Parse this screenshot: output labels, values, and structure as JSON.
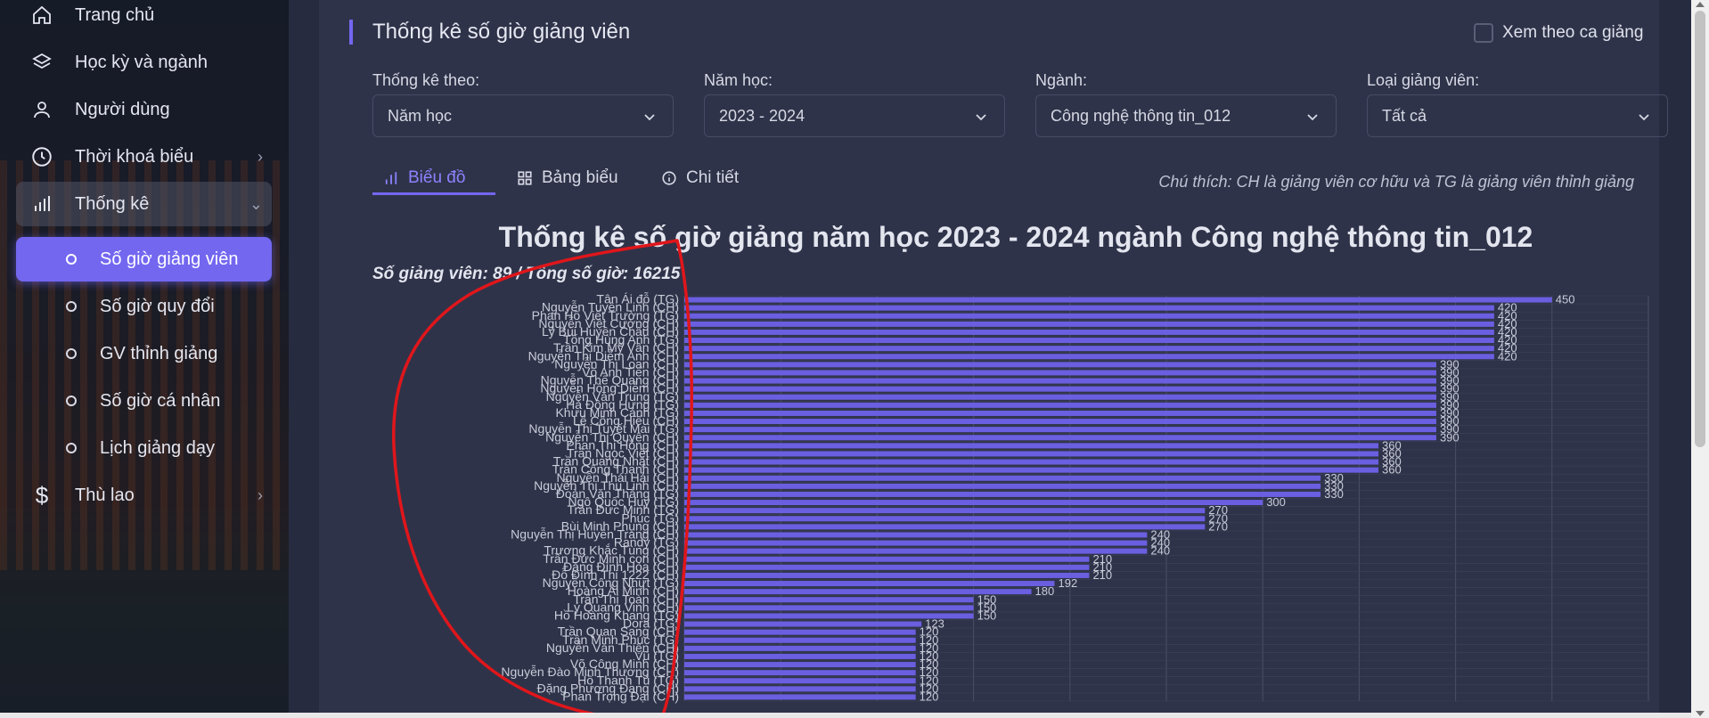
{
  "sidebar": {
    "items": [
      {
        "label": "Trang chủ",
        "icon": "home-icon"
      },
      {
        "label": "Học kỳ và ngành",
        "icon": "layers-icon"
      },
      {
        "label": "Người dùng",
        "icon": "user-icon"
      },
      {
        "label": "Thời khoá biểu",
        "icon": "clock-icon"
      },
      {
        "label": "Thống kê",
        "icon": "bar-chart-icon"
      }
    ],
    "sub_items": [
      {
        "label": "Số giờ giảng viên",
        "active": true
      },
      {
        "label": "Số giờ quy đổi"
      },
      {
        "label": "GV thỉnh giảng"
      },
      {
        "label": "Số giờ cá nhân"
      },
      {
        "label": "Lịch giảng dạy"
      }
    ],
    "last_item": {
      "label": "Thù lao",
      "icon": "dollar-icon"
    }
  },
  "header": {
    "title": "Thống kê số giờ giảng viên",
    "toggle_label": "Xem theo ca giảng"
  },
  "filters": [
    {
      "label": "Thống kê theo:",
      "value": "Năm học"
    },
    {
      "label": "Năm học:",
      "value": "2023 - 2024"
    },
    {
      "label": "Ngành:",
      "value": "Công nghệ thông tin_012"
    },
    {
      "label": "Loại giảng viên:",
      "value": "Tất cả"
    }
  ],
  "tabs": [
    {
      "label": "Biểu đồ",
      "icon": "bar-chart-icon",
      "active": true
    },
    {
      "label": "Bảng biểu",
      "icon": "grid-icon"
    },
    {
      "label": "Chi tiết",
      "icon": "info-icon"
    }
  ],
  "note": "Chú thích: CH là giảng viên cơ hữu và TG là giảng viên thỉnh giảng",
  "colors": {
    "accent": "#7367f0",
    "bar": "#6a5fe0",
    "annotation": "#e0161b"
  },
  "chart_data": {
    "type": "bar",
    "orientation": "horizontal",
    "title": "Thống kê số giờ giảng năm học 2023 - 2024 ngành Công nghệ thông tin_012",
    "subtitle": "Số giảng viên: 89 / Tổng số giờ: 16215",
    "categories": [
      "Tân Ái đỗ (TG)",
      "Nguyễn Tuyền Linh (CH)",
      "Phan Hồ Viết Trường (TG)",
      "Nguyễn Việt Cường (CH)",
      "Lý Bùi Huyền Châu (CH)",
      "Tống Hùng Anh (TG)",
      "Trần Kim Mỹ Vân (CH)",
      "Nguyễn Thị Diễm Anh (CH)",
      "Nguyễn Thị Loan (CH)",
      "Võ Anh Tiến (CH)",
      "Nguyễn Thế Quang (CH)",
      "Nguyễn Hồng Diễm (CH)",
      "Nguyễn Văn Trung (TG)",
      "Hà Đông Hưng (TG)",
      "Khưu Minh Cảnh (TG)",
      "Lê Công Hiếu (CH)",
      "Nguyễn Thị Tuyết Mai (TG)",
      "Nguyễn Thị Quyên (CH)",
      "Phan Thị Hồng (CH)",
      "Trần Ngọc Việt (CH)",
      "Trần Quang Nhật (CH)",
      "Trần Công Thanh (CH)",
      "Nguyễn Thái Hải (CH)",
      "Nguyễn Thị Thu Linh (CH)",
      "Đoàn Văn Thắng (TG)",
      "Ngô Quốc Huy (TG)",
      "Trần Đức Minh (TG)",
      "Phúc (TG)",
      "Bùi Minh Phụng (CH)",
      "Nguyễn Thị Huyền Trang (CH)",
      "Randy (TG)",
      "Trương Khắc Tùng (CH)",
      "Trần Đức Minh con (CH)",
      "Đặng Đình Hòa (CH)",
      "Đỗ Đình Thi 1222 (CH)",
      "Nguyễn Công Nhựt (TG)",
      "Hoàng Ái Minh (CH)",
      "Trần Thị Toàn (CH)",
      "Lý Quang Vinh (CH)",
      "Hồ Hoàng Khang (TG)",
      "Dora (TG)",
      "Trần Quan Sang (CH)",
      "Trần Minh Phúc (TG)",
      "Nguyễn Văn Thiện (CH)",
      "Vũ (TG)",
      "Võ Công Minh (CH)",
      "Nguyễn Đào Minh Thương (CH)",
      "Hồ Thanh Tú (TG)",
      "Đặng Phương Đạng (CH)",
      "Phan Trọng Đại (CH)"
    ],
    "values": [
      450,
      420,
      420,
      420,
      420,
      420,
      420,
      420,
      390,
      390,
      390,
      390,
      390,
      390,
      390,
      390,
      390,
      390,
      360,
      360,
      360,
      360,
      330,
      330,
      330,
      300,
      270,
      270,
      270,
      240,
      240,
      240,
      210,
      210,
      210,
      192,
      180,
      150,
      150,
      150,
      123,
      120,
      120,
      120,
      120,
      120,
      120,
      120,
      120,
      120
    ],
    "xlim": [
      0,
      500
    ],
    "grid": true
  }
}
